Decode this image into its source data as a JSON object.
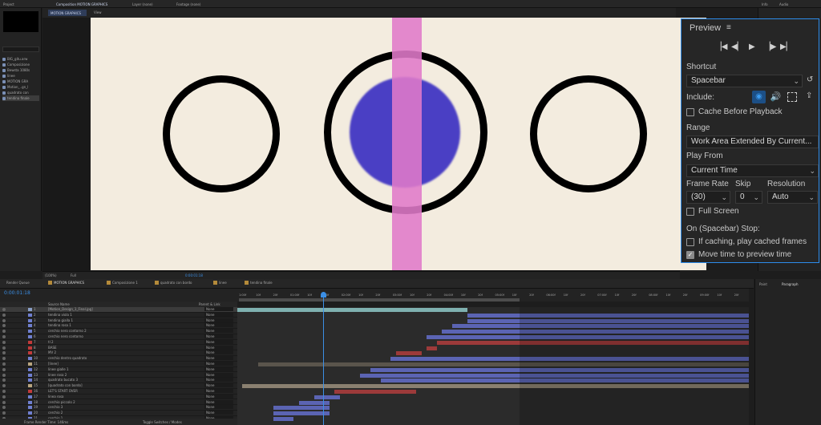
{
  "topbar": {
    "project_tab": "Project",
    "comp_tab": "Composition MOTION GRAPHICS",
    "layer_tab": "Layer (none)",
    "footage_tab": "Footage (none)",
    "info_tab": "Info",
    "audio_tab": "Audio"
  },
  "project": {
    "items": [
      "BIG_gitu.arw",
      "Composizione",
      "Bewsta 1080s",
      "linee",
      "MOTION GRA",
      "Motion_..gn_l",
      "quadrato con",
      "tendina finale"
    ]
  },
  "viewer": {
    "comp_subtab": "MOTION GRAPHICS",
    "view_label": "View",
    "zoom": "(100%)",
    "resolution": "Full",
    "timecode": "0:00:01:18"
  },
  "preview": {
    "title": "Preview",
    "shortcut_label": "Shortcut",
    "shortcut_value": "Spacebar",
    "include_label": "Include:",
    "cache_label": "Cache Before Playback",
    "range_label": "Range",
    "range_value": "Work Area Extended By Current...",
    "play_from_label": "Play From",
    "play_from_value": "Current Time",
    "frame_rate_label": "Frame Rate",
    "skip_label": "Skip",
    "resolution_label": "Resolution",
    "frame_rate_value": "(30)",
    "skip_value": "0",
    "resolution_value": "Auto",
    "full_screen_label": "Full Screen",
    "on_stop_label": "On (Spacebar) Stop:",
    "if_caching_label": "If caching, play cached frames",
    "move_time_label": "Move time to preview time",
    "cache_checked": false,
    "full_screen_checked": false,
    "if_caching_checked": false,
    "move_time_checked": true
  },
  "timeline": {
    "tabs": [
      {
        "label": "Render Queue",
        "color": "#262626"
      },
      {
        "label": "MOTION GRAPHICS",
        "color": "#b48a3a"
      },
      {
        "label": "Composizione 1",
        "color": "#b48a3a"
      },
      {
        "label": "quadrato con bordo",
        "color": "#b48a3a"
      },
      {
        "label": "linee",
        "color": "#b48a3a"
      },
      {
        "label": "tendina finale",
        "color": "#b48a3a"
      }
    ],
    "current_time": "0:00:01:18",
    "header_source": "Source Name",
    "header_parent": "Parent & Link",
    "parent_value": "None",
    "status": "Frame Render Time: 146ms",
    "toggle": "Toggle Switches / Modes",
    "layers": [
      {
        "num": "1",
        "name": "[Motion_Design_1_Final.jpg]",
        "color": "#8aa0c8",
        "track": [
          0.0,
          0.45
        ],
        "track_color": "#7fb1b0"
      },
      {
        "num": "2",
        "name": "tendina viola 1",
        "color": "#6f7fd0",
        "track": [
          0.45,
          1.0
        ],
        "track_color": "#5b64b3"
      },
      {
        "num": "3",
        "name": "tendina gialla 1",
        "color": "#6f7fd0",
        "track": [
          0.45,
          1.0
        ],
        "track_color": "#5b64b3"
      },
      {
        "num": "4",
        "name": "tendina rosa 1",
        "color": "#6f7fd0",
        "track": [
          0.42,
          1.0
        ],
        "track_color": "#5b64b3"
      },
      {
        "num": "5",
        "name": "cerchio nero contorno 2",
        "color": "#6f7fd0",
        "track": [
          0.4,
          1.0
        ],
        "track_color": "#5b64b3"
      },
      {
        "num": "6",
        "name": "cerchio nero contorno",
        "color": "#6f7fd0",
        "track": [
          0.37,
          1.0
        ],
        "track_color": "#5b64b3"
      },
      {
        "num": "7",
        "name": "tl 2",
        "color": "#c23a3a",
        "track": [
          0.39,
          1.0
        ],
        "track_color": "#9c3a3a"
      },
      {
        "num": "8",
        "name": "BASE",
        "color": "#c23a3a",
        "track": [
          0.37,
          0.39
        ],
        "track_color": "#9c3a3a"
      },
      {
        "num": "9",
        "name": "MV 2",
        "color": "#c23a3a",
        "track": [
          0.31,
          0.36
        ],
        "track_color": "#9c3a3a"
      },
      {
        "num": "10",
        "name": "cerchio dentro quadrato",
        "color": "#6f7fd0",
        "track": [
          0.3,
          1.0
        ],
        "track_color": "#5b64b3"
      },
      {
        "num": "11",
        "name": "[linee]",
        "color": "#b9a57f",
        "track": [
          0.04,
          1.0
        ],
        "track_color": "#5a554c"
      },
      {
        "num": "12",
        "name": "linee gialle 1",
        "color": "#6f7fd0",
        "track": [
          0.26,
          1.0
        ],
        "track_color": "#5b64b3"
      },
      {
        "num": "13",
        "name": "linee rosa 2",
        "color": "#6f7fd0",
        "track": [
          0.24,
          1.0
        ],
        "track_color": "#5b64b3"
      },
      {
        "num": "14",
        "name": "quadrato bucato 3",
        "color": "#6f7fd0",
        "track": [
          0.28,
          1.0
        ],
        "track_color": "#5b64b3"
      },
      {
        "num": "15",
        "name": "[quadrato con bordo]",
        "color": "#b9a57f",
        "track": [
          0.01,
          1.0
        ],
        "track_color": "#8a8070"
      },
      {
        "num": "16",
        "name": "LET'S START OVER",
        "color": "#c23a3a",
        "track": [
          0.19,
          0.35
        ],
        "track_color": "#9c3a3a"
      },
      {
        "num": "17",
        "name": "linea rosa",
        "color": "#6f7fd0",
        "track": [
          0.15,
          0.2
        ],
        "track_color": "#5b64b3"
      },
      {
        "num": "18",
        "name": "cerchio piccolo 2",
        "color": "#6f7fd0",
        "track": [
          0.12,
          0.18
        ],
        "track_color": "#5b64b3"
      },
      {
        "num": "19",
        "name": "cerchio 3",
        "color": "#6f7fd0",
        "track": [
          0.07,
          0.18
        ],
        "track_color": "#5b64b3"
      },
      {
        "num": "20",
        "name": "cerchio 2",
        "color": "#6f7fd0",
        "track": [
          0.07,
          0.18
        ],
        "track_color": "#5b64b3"
      },
      {
        "num": "21",
        "name": "cerchio 1",
        "color": "#6f7fd0",
        "track": [
          0.07,
          0.11
        ],
        "track_color": "#5b64b3"
      }
    ],
    "ruler_ticks": [
      "1:00f",
      "10f",
      "20f",
      "01:00f",
      "10f",
      "20f",
      "02:00f",
      "10f",
      "20f",
      "03:00f",
      "10f",
      "20f",
      "04:00f",
      "10f",
      "20f",
      "05:00f",
      "10f",
      "20f",
      "06:00f",
      "10f",
      "20f",
      "07:00f",
      "10f",
      "20f",
      "08:00f",
      "10f",
      "20f",
      "09:00f",
      "10f",
      "20f"
    ]
  },
  "right_panels": {
    "paint_tab": "Paint",
    "paragraph_tab": "Paragraph"
  },
  "colors": {
    "accent": "#2d8ceb",
    "canvas_bg": "#f3ecdf",
    "bar": "#e07ac9",
    "blob": "#4a3fc4"
  }
}
